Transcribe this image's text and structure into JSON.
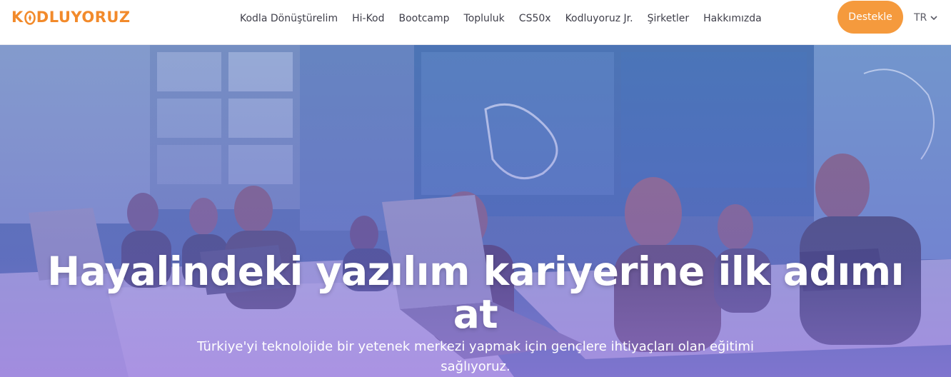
{
  "brand": {
    "name_prefix": "K",
    "name_suffix": "DLUYORUZ",
    "color": "#f28a2b"
  },
  "nav": {
    "items": [
      {
        "label": "Kodla Dönüştürelim"
      },
      {
        "label": "Hi-Kod"
      },
      {
        "label": "Bootcamp"
      },
      {
        "label": "Topluluk"
      },
      {
        "label": "CS50x"
      },
      {
        "label": "Kodluyoruz Jr."
      },
      {
        "label": "Şirketler"
      },
      {
        "label": "Hakkımızda"
      }
    ],
    "support_label": "Destekle",
    "language": "TR",
    "accent": "#f59a3d"
  },
  "hero": {
    "title": "Hayalindeki yazılım kariyerine ilk adımı at",
    "subtitle": "Türkiye'yi teknolojide bir yetenek merkezi yapmak için gençlere ihtiyaçları olan eğitimi sağlıyoruz.",
    "background_description_icon": "classroom-photo"
  }
}
